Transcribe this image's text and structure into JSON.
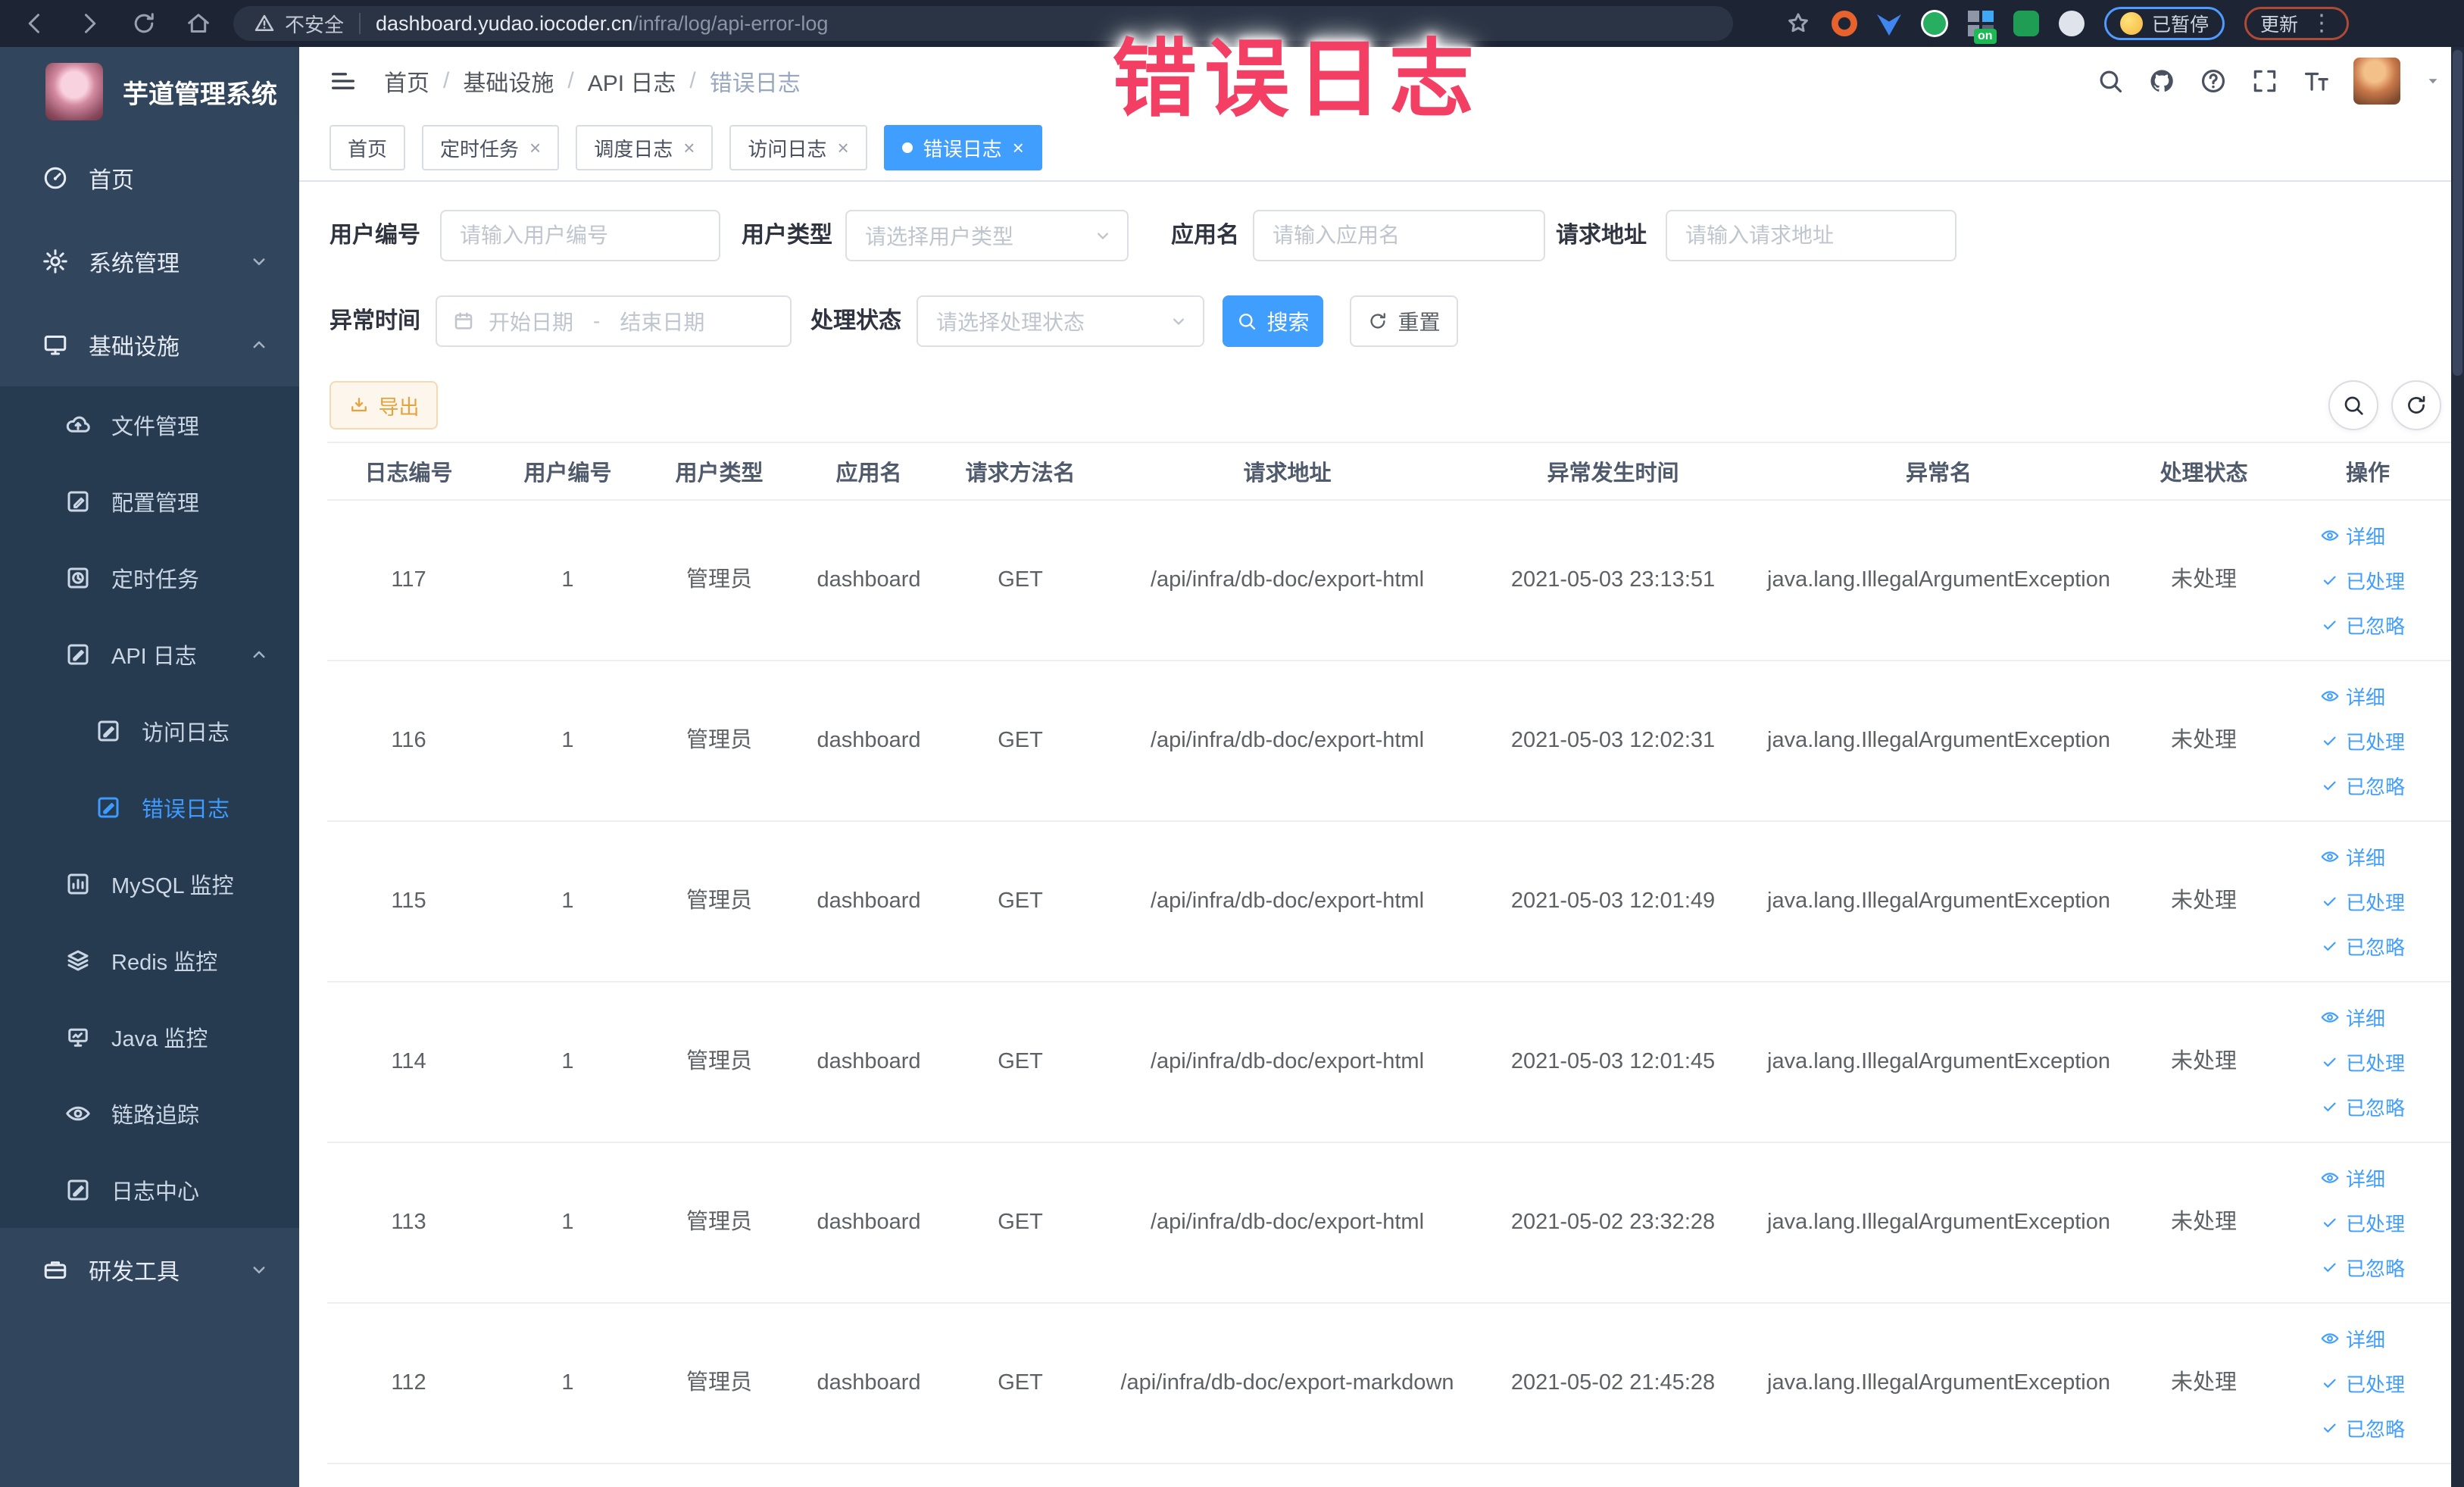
{
  "annotation": "错误日志",
  "browser": {
    "security_label": "不安全",
    "url_host": "dashboard.yudao.iocoder.cn",
    "url_path": "/infra/log/api-error-log",
    "on_badge": "on",
    "paused_badge": "已暂停",
    "update_button": "更新",
    "menu_dots": "⋮"
  },
  "sidebar": {
    "title": "芋道管理系统",
    "items": [
      {
        "key": "home",
        "label": "首页",
        "icon": "gauge",
        "level": 1
      },
      {
        "key": "system",
        "label": "系统管理",
        "icon": "gear",
        "level": 1,
        "chevron": "down"
      },
      {
        "key": "infra",
        "label": "基础设施",
        "icon": "screen",
        "level": 1,
        "chevron": "up"
      },
      {
        "key": "file",
        "label": "文件管理",
        "icon": "cloud",
        "level": 2,
        "dark": true
      },
      {
        "key": "config",
        "label": "配置管理",
        "icon": "pen",
        "level": 2,
        "dark": true
      },
      {
        "key": "job",
        "label": "定时任务",
        "icon": "task",
        "level": 2,
        "dark": true
      },
      {
        "key": "api-log",
        "label": "API 日志",
        "icon": "logfile",
        "level": 2,
        "dark": true,
        "chevron": "up"
      },
      {
        "key": "access-log",
        "label": "访问日志",
        "icon": "logfile",
        "level": 3,
        "dark": true
      },
      {
        "key": "error-log",
        "label": "错误日志",
        "icon": "logfile",
        "level": 3,
        "dark": true,
        "active": true
      },
      {
        "key": "mysql",
        "label": "MySQL 监控",
        "icon": "chart",
        "level": 2,
        "dark": true
      },
      {
        "key": "redis",
        "label": "Redis 监控",
        "icon": "layers",
        "level": 2,
        "dark": true
      },
      {
        "key": "java",
        "label": "Java 监控",
        "icon": "monitor",
        "level": 2,
        "dark": true
      },
      {
        "key": "tracer",
        "label": "链路追踪",
        "icon": "eye",
        "level": 2,
        "dark": true
      },
      {
        "key": "log-center",
        "label": "日志中心",
        "icon": "logfile",
        "level": 2,
        "dark": true
      },
      {
        "key": "dev-tool",
        "label": "研发工具",
        "icon": "toolbox",
        "level": 1,
        "chevron": "down"
      }
    ]
  },
  "header": {
    "breadcrumb": [
      "首页",
      "基础设施",
      "API 日志",
      "错误日志"
    ]
  },
  "tabs": [
    {
      "key": "home",
      "label": "首页",
      "closable": false,
      "active": false
    },
    {
      "key": "job",
      "label": "定时任务",
      "closable": true,
      "active": false
    },
    {
      "key": "job-log",
      "label": "调度日志",
      "closable": true,
      "active": false
    },
    {
      "key": "access-log",
      "label": "访问日志",
      "closable": true,
      "active": false
    },
    {
      "key": "error-log",
      "label": "错误日志",
      "closable": true,
      "active": true
    }
  ],
  "filters": {
    "user_id_label": "用户编号",
    "user_id_placeholder": "请输入用户编号",
    "user_type_label": "用户类型",
    "user_type_placeholder": "请选择用户类型",
    "app_name_label": "应用名",
    "app_name_placeholder": "请输入应用名",
    "request_url_label": "请求地址",
    "request_url_placeholder": "请输入请求地址",
    "exception_time_label": "异常时间",
    "start_date_placeholder": "开始日期",
    "date_separator": "-",
    "end_date_placeholder": "结束日期",
    "process_status_label": "处理状态",
    "process_status_placeholder": "请选择处理状态",
    "search_button": "搜索",
    "reset_button": "重置"
  },
  "toolbar": {
    "export_button": "导出"
  },
  "table": {
    "columns": [
      "日志编号",
      "用户编号",
      "用户类型",
      "应用名",
      "请求方法名",
      "请求地址",
      "异常发生时间",
      "异常名",
      "处理状态",
      "操作"
    ],
    "actions": [
      "详细",
      "已处理",
      "已忽略"
    ],
    "rows": [
      {
        "id": "117",
        "user_id": "1",
        "user_type": "管理员",
        "app": "dashboard",
        "method": "GET",
        "url": "/api/infra/db-doc/export-html",
        "time": "2021-05-03 23:13:51",
        "exception": "java.lang.IllegalArgumentException",
        "status": "未处理"
      },
      {
        "id": "116",
        "user_id": "1",
        "user_type": "管理员",
        "app": "dashboard",
        "method": "GET",
        "url": "/api/infra/db-doc/export-html",
        "time": "2021-05-03 12:02:31",
        "exception": "java.lang.IllegalArgumentException",
        "status": "未处理"
      },
      {
        "id": "115",
        "user_id": "1",
        "user_type": "管理员",
        "app": "dashboard",
        "method": "GET",
        "url": "/api/infra/db-doc/export-html",
        "time": "2021-05-03 12:01:49",
        "exception": "java.lang.IllegalArgumentException",
        "status": "未处理"
      },
      {
        "id": "114",
        "user_id": "1",
        "user_type": "管理员",
        "app": "dashboard",
        "method": "GET",
        "url": "/api/infra/db-doc/export-html",
        "time": "2021-05-03 12:01:45",
        "exception": "java.lang.IllegalArgumentException",
        "status": "未处理"
      },
      {
        "id": "113",
        "user_id": "1",
        "user_type": "管理员",
        "app": "dashboard",
        "method": "GET",
        "url": "/api/infra/db-doc/export-html",
        "time": "2021-05-02 23:32:28",
        "exception": "java.lang.IllegalArgumentException",
        "status": "未处理"
      },
      {
        "id": "112",
        "user_id": "1",
        "user_type": "管理员",
        "app": "dashboard",
        "method": "GET",
        "url": "/api/infra/db-doc/export-markdown",
        "time": "2021-05-02 21:45:28",
        "exception": "java.lang.IllegalArgumentException",
        "status": "未处理"
      }
    ]
  },
  "colors": {
    "primary": "#409eff",
    "warning": "#e6a23c",
    "sidebar_bg": "#31455c",
    "submenu_bg": "#263a50",
    "chrome_bg": "#1d2433",
    "annotation": "#f33f63"
  }
}
